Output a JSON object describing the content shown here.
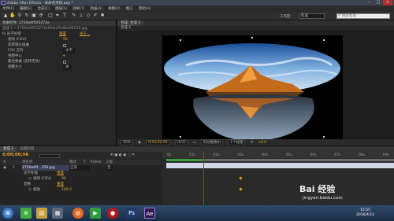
{
  "app": {
    "title": "Adobe After Effects - 未命名项目.aep *",
    "window_controls": [
      "–",
      "□",
      "✕"
    ]
  },
  "menu": [
    "文件(F)",
    "编辑(E)",
    "合成(C)",
    "图层(L)",
    "效果(T)",
    "动画(A)",
    "视图(V)",
    "窗口",
    "帮助(H)"
  ],
  "toolbar": {
    "tools": [
      "selection-tool",
      "hand-tool",
      "zoom-tool",
      "rotate-tool",
      "camera-tool",
      "pan-behind-tool",
      "rectangle-tool",
      "pen-tool",
      "type-tool",
      "brush-tool",
      "clone-stamp-tool",
      "eraser-tool",
      "roto-brush-tool",
      "puppet-tool"
    ],
    "workspace_label": "工作区:",
    "workspace_value": "标准",
    "search_placeholder": "搜索帮助"
  },
  "effect_controls": {
    "tab": "效果控件: 2750e6ff5f3272e",
    "subtitle": "合成 1 • 2750e6ff5f3272e0fa4ef5d6e4f6259.jpg",
    "effect_name": "fx 光学补偿",
    "reset": "重置",
    "about": "关于...",
    "rows": [
      {
        "label": "视场 (FOV)",
        "value": "90"
      },
      {
        "label": "反转镜头扭曲",
        "value": ""
      },
      {
        "label": "FOV 方向",
        "value": "水平"
      },
      {
        "label": "视图中心",
        "value": ""
      },
      {
        "label": "最佳像素 (反转无效)",
        "value": ""
      },
      {
        "label": "调整大小",
        "value": "关"
      }
    ]
  },
  "composition": {
    "tab": "合成: 合成 1",
    "subtab": "合成 1",
    "footer": [
      "50%",
      "0;00;00;00",
      "(1/2)",
      "有效摄像机",
      "1个视图",
      "+0.0"
    ]
  },
  "timeline": {
    "tabs": [
      "合成 1",
      "渲染队列"
    ],
    "timecode": "0;00;00;06",
    "frames": "00006 (29.97 fps)",
    "layer_header": [
      "#",
      "源名称",
      "模式",
      "T",
      "TrkMat",
      "父级"
    ],
    "layer": {
      "index": "1",
      "name": "2750e6ff...259.jpg",
      "mode": "正常",
      "parent": "无"
    },
    "properties": [
      {
        "label": "光学补偿",
        "value": "重置"
      },
      {
        "label": "视场 (FOV)",
        "value": "90"
      },
      {
        "label": "变换",
        "value": "重置"
      },
      {
        "label": "缩放",
        "value": "100.0"
      }
    ],
    "ruler_ticks": [
      "0s",
      "01s",
      "02s",
      "03s",
      "04s",
      "05s",
      "06s",
      "07s",
      "08s",
      "09s"
    ]
  },
  "taskbar": {
    "apps": [
      "start",
      "360",
      "folder",
      "media",
      "firefox",
      "player",
      "recorder",
      "photoshop",
      "after-effects"
    ],
    "clock_time": "15:55",
    "clock_date": "2016/4/12"
  },
  "watermark": {
    "text": "Bai 经验",
    "url": "jingyan.baidu.com"
  },
  "colors": {
    "accent_orange": "#e0a030",
    "playhead_red": "#d02020",
    "work_area_green": "#3aa03a"
  }
}
